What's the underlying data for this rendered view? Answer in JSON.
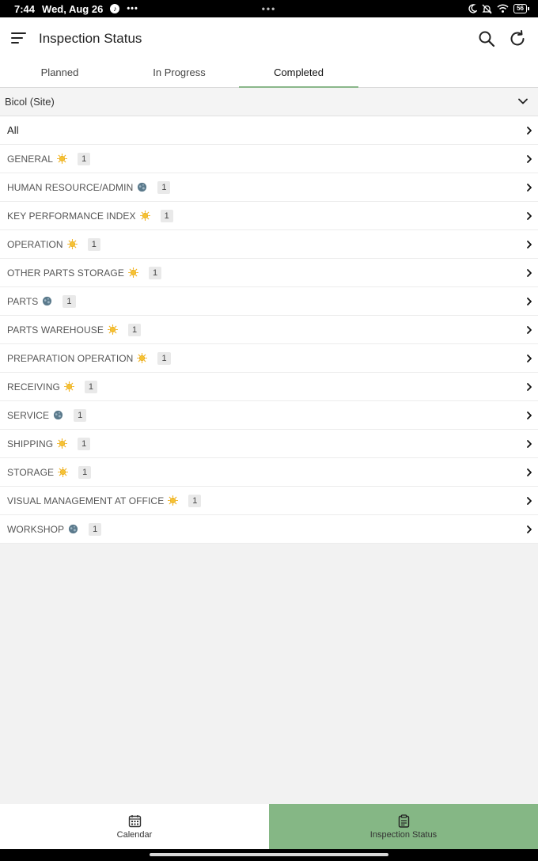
{
  "status_bar": {
    "time": "7:44",
    "date": "Wed, Aug 26",
    "notif_icons": [
      "tiktok-icon",
      "more-dots-icon"
    ],
    "center": "•••",
    "battery": "56"
  },
  "appbar": {
    "title": "Inspection Status",
    "icons": [
      "menu-icon",
      "search-icon",
      "refresh-icon"
    ]
  },
  "tabs": [
    {
      "label": "Planned",
      "active": false
    },
    {
      "label": "In Progress",
      "active": false
    },
    {
      "label": "Completed",
      "active": true
    }
  ],
  "site": {
    "label": "Bicol (Site)"
  },
  "list": {
    "all_label": "All",
    "items": [
      {
        "label": "GENERAL",
        "weather": "sun",
        "count": "1"
      },
      {
        "label": "HUMAN RESOURCE/ADMIN",
        "weather": "cloud",
        "count": "1"
      },
      {
        "label": "KEY PERFORMANCE INDEX",
        "weather": "sun",
        "count": "1"
      },
      {
        "label": "OPERATION",
        "weather": "sun",
        "count": "1"
      },
      {
        "label": "OTHER PARTS STORAGE",
        "weather": "sun",
        "count": "1"
      },
      {
        "label": "PARTS",
        "weather": "cloud",
        "count": "1"
      },
      {
        "label": "PARTS WAREHOUSE",
        "weather": "sun",
        "count": "1"
      },
      {
        "label": "PREPARATION OPERATION",
        "weather": "sun",
        "count": "1"
      },
      {
        "label": "RECEIVING",
        "weather": "sun",
        "count": "1"
      },
      {
        "label": "SERVICE",
        "weather": "cloud",
        "count": "1"
      },
      {
        "label": "SHIPPING",
        "weather": "sun",
        "count": "1"
      },
      {
        "label": "STORAGE",
        "weather": "sun",
        "count": "1"
      },
      {
        "label": "VISUAL MANAGEMENT AT OFFICE",
        "weather": "sun",
        "count": "1"
      },
      {
        "label": "WORKSHOP",
        "weather": "cloud",
        "count": "1"
      }
    ]
  },
  "bottom_nav": [
    {
      "label": "Calendar",
      "icon": "calendar-icon",
      "active": false
    },
    {
      "label": "Inspection Status",
      "icon": "clipboard-icon",
      "active": true
    }
  ],
  "colors": {
    "accent": "#85b785",
    "tab_underline": "#8ab78a",
    "sun": "#f2b21b",
    "cloud": "#5b7a8c"
  }
}
